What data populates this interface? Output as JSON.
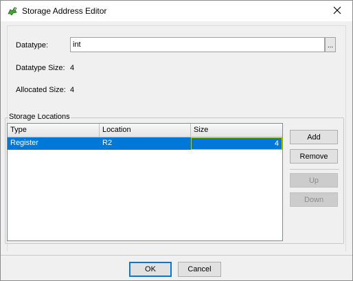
{
  "window": {
    "title": "Storage Address Editor",
    "app_icon": "dragon-icon",
    "close_icon": "close-icon"
  },
  "fields": {
    "datatype_label": "Datatype:",
    "datatype_value": "int",
    "browse_label": "...",
    "datatype_size_label": "Datatype Size:",
    "datatype_size_value": "4",
    "allocated_size_label": "Allocated Size:",
    "allocated_size_value": "4"
  },
  "storage": {
    "group_title": "Storage Locations",
    "columns": [
      "Type",
      "Location",
      "Size"
    ],
    "rows": [
      {
        "type": "Register",
        "location": "R2",
        "size": "4",
        "selected": true
      }
    ]
  },
  "buttons": {
    "add": "Add",
    "remove": "Remove",
    "up": "Up",
    "down": "Down",
    "ok": "OK",
    "cancel": "Cancel"
  },
  "colors": {
    "selection": "#0078d7",
    "edit_border": "#b3d200"
  }
}
